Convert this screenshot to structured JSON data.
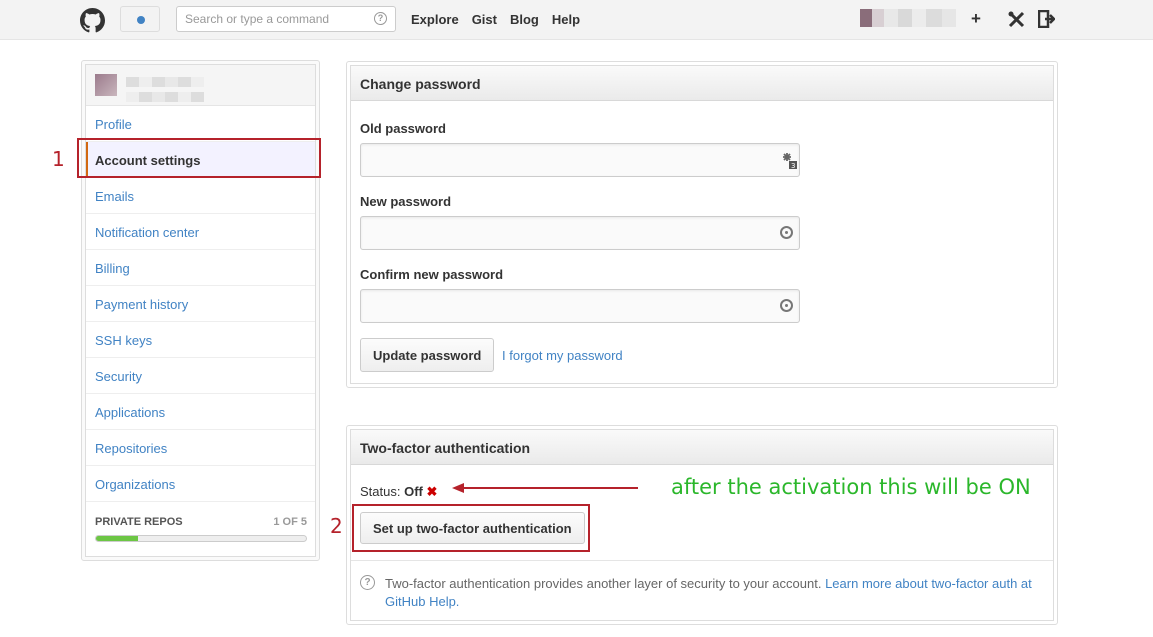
{
  "header": {
    "search_placeholder": "Search or type a command",
    "help_glyph": "?",
    "nav": [
      "Explore",
      "Gist",
      "Blog",
      "Help"
    ],
    "plus_icon": "+",
    "tools_icon": "✕",
    "signout_icon": "⇥"
  },
  "sidebar": {
    "items": [
      {
        "label": "Profile",
        "active": false
      },
      {
        "label": "Account settings",
        "active": true
      },
      {
        "label": "Emails",
        "active": false
      },
      {
        "label": "Notification center",
        "active": false
      },
      {
        "label": "Billing",
        "active": false
      },
      {
        "label": "Payment history",
        "active": false
      },
      {
        "label": "SSH keys",
        "active": false
      },
      {
        "label": "Security",
        "active": false
      },
      {
        "label": "Applications",
        "active": false
      },
      {
        "label": "Repositories",
        "active": false
      },
      {
        "label": "Organizations",
        "active": false
      }
    ],
    "private_repos_label": "PRIVATE REPOS",
    "private_repos_count": "1 OF 5",
    "private_repos_progress": 0.2
  },
  "change_password": {
    "title": "Change password",
    "old_label": "Old password",
    "new_label": "New password",
    "confirm_label": "Confirm new password",
    "update_button": "Update password",
    "forgot_link": "I forgot my password"
  },
  "two_factor": {
    "title": "Two-factor authentication",
    "status_label": "Status:",
    "status_value": "Off",
    "status_icon": "✖",
    "setup_button": "Set up two-factor authentication",
    "help_glyph": "?",
    "info_text": "Two-factor authentication provides another layer of security to your account.",
    "learn_link": "Learn more about two-factor auth at GitHub Help."
  },
  "annotations": {
    "num1": "1",
    "num2": "2",
    "note": "after the activation this will be ON"
  },
  "colors": {
    "annotation_red": "#b5222b",
    "annotation_green": "#2bb72b",
    "link_blue": "#4183c4",
    "active_marker": "#d26911"
  }
}
